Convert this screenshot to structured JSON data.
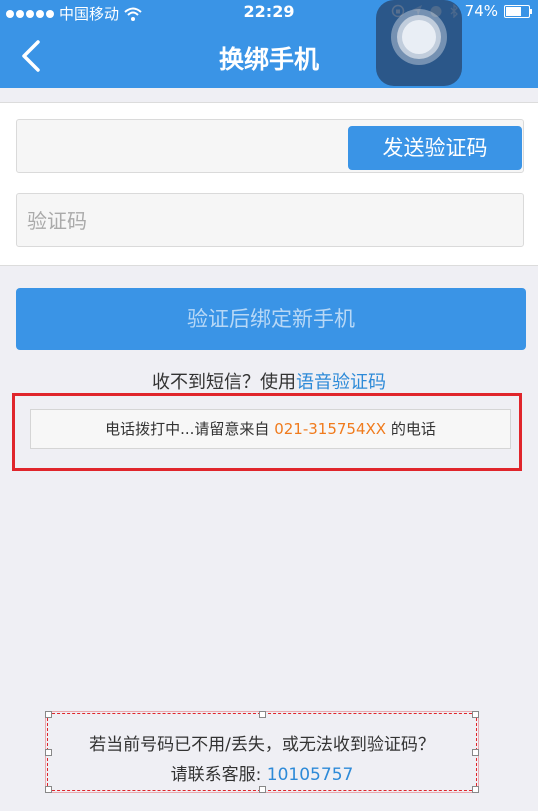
{
  "status_bar": {
    "carrier": "中国移动",
    "time": "22:29",
    "battery": "74%",
    "battery_level": 0.74
  },
  "nav": {
    "title": "换绑手机",
    "back_icon": "chevron-left-icon"
  },
  "form": {
    "phone_value": "",
    "send_code_label": "发送验证码",
    "code_placeholder": "验证码"
  },
  "verify_button_label": "验证后绑定新手机",
  "sms_hint": {
    "prefix": "收不到短信？使用",
    "voice_link": "语音验证码"
  },
  "call_notice": {
    "prefix": "电话拨打中...请留意来自",
    "phone": "021-315754XX",
    "suffix": "的电话"
  },
  "help": {
    "line1": "若当前号码已不用/丢失，或无法收到验证码？",
    "line2_prefix": "请联系客服:",
    "service_number": "10105757"
  },
  "colors": {
    "primary": "#3a94e6",
    "link": "#2d8ad8",
    "highlight_phone": "#f07b1d",
    "annotation_red": "#e0252b"
  }
}
